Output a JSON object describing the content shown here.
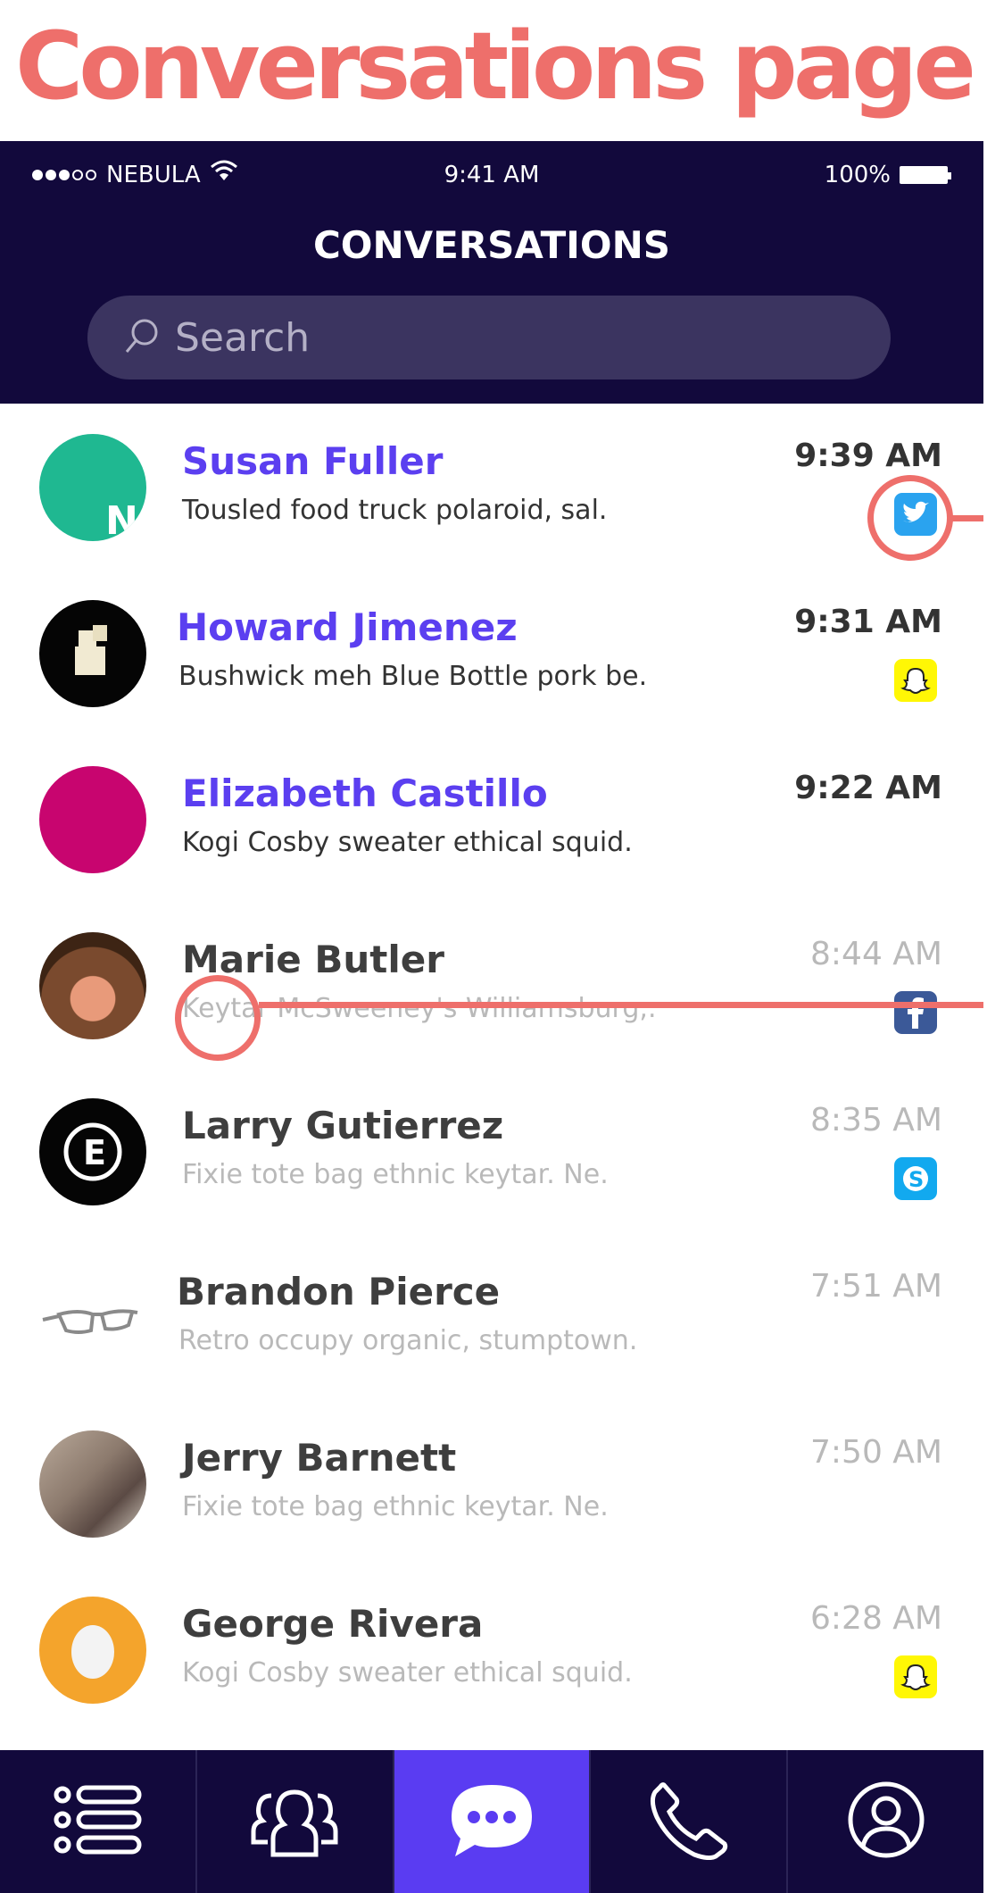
{
  "page_heading": "Conversations page",
  "status_bar": {
    "carrier": "NEBULA",
    "time": "9:41 AM",
    "battery": "100%"
  },
  "header": {
    "title": "CONVERSATIONS"
  },
  "search": {
    "placeholder": "Search",
    "icon": "search-icon"
  },
  "conversations": [
    {
      "name": "Susan Fuller",
      "preview": "Tousled food truck polaroid, sal.",
      "time": "9:39 AM",
      "unread": true,
      "source": "twitter"
    },
    {
      "name": "Howard Jimenez",
      "preview": "Bushwick meh Blue Bottle pork be.",
      "time": "9:31 AM",
      "unread": true,
      "source": "snapchat"
    },
    {
      "name": "Elizabeth Castillo",
      "preview": "Kogi Cosby sweater ethical squid.",
      "time": "9:22 AM",
      "unread": true,
      "source": ""
    },
    {
      "name": "Marie Butler",
      "preview": "Keytar McSweeney's Williamsburg,.",
      "time": "8:44 AM",
      "unread": false,
      "source": "facebook"
    },
    {
      "name": "Larry Gutierrez",
      "preview": "Fixie tote bag ethnic keytar. Ne.",
      "time": "8:35 AM",
      "unread": false,
      "source": "skype"
    },
    {
      "name": "Brandon Pierce",
      "preview": "Retro occupy organic, stumptown.",
      "time": "7:51 AM",
      "unread": false,
      "source": ""
    },
    {
      "name": "Jerry Barnett",
      "preview": "Fixie tote bag ethnic keytar. Ne.",
      "time": "7:50 AM",
      "unread": false,
      "source": ""
    },
    {
      "name": "George Rivera",
      "preview": "Kogi Cosby sweater ethical squid.",
      "time": "6:28 AM",
      "unread": false,
      "source": "snapchat"
    }
  ],
  "tabs": [
    {
      "icon": "list-icon",
      "active": false
    },
    {
      "icon": "contacts-icon",
      "active": false
    },
    {
      "icon": "chat-bubble-icon",
      "active": true
    },
    {
      "icon": "phone-icon",
      "active": false
    },
    {
      "icon": "profile-icon",
      "active": false
    }
  ],
  "colors": {
    "header_bg": "#12093c",
    "accent": "#5a3cf2",
    "unread_name": "#5b3ff0",
    "annotation": "#ee6f6b",
    "read_text": "#b9b9b9"
  }
}
